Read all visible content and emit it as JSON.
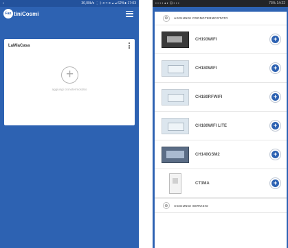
{
  "left": {
    "statusbar": {
      "left": "▪",
      "right": "30,00k/s ⋮ ᛒ ⊙ ≈ ⊘ ◢ ◢ 62%▮ 17:03"
    },
    "app_title": "tiniCosmi",
    "logo_text": "Fan",
    "home_card": {
      "title": "LaMiaCasa",
      "add_symbol": "+",
      "add_caption": "aggiungi cronotermostato"
    }
  },
  "right": {
    "statusbar": {
      "left": "▪ ▪ ▪ ▪ ◂ ◐ ⊡ ▪ ▪ ▪",
      "right": "73% 14:22"
    },
    "sections": {
      "add_chrono": "AGGIUNGI CRONOTERMOSTATO",
      "add_service": "AGGIUNGI SERVIZIO"
    },
    "devices": [
      {
        "name": "CH193WIFI",
        "thumb": "dark"
      },
      {
        "name": "CH180WIFI",
        "thumb": "light"
      },
      {
        "name": "CH180RFWIFI",
        "thumb": "light"
      },
      {
        "name": "CH180WIFI LITE",
        "thumb": "light"
      },
      {
        "name": "CH140GSM2",
        "thumb": "gsm"
      },
      {
        "name": "CT3MA",
        "thumb": "tall"
      }
    ],
    "add_symbol": "+",
    "section_symbol": "⊕"
  },
  "colors": {
    "brand_blue": "#2d62b2",
    "card_white": "#ffffff"
  }
}
